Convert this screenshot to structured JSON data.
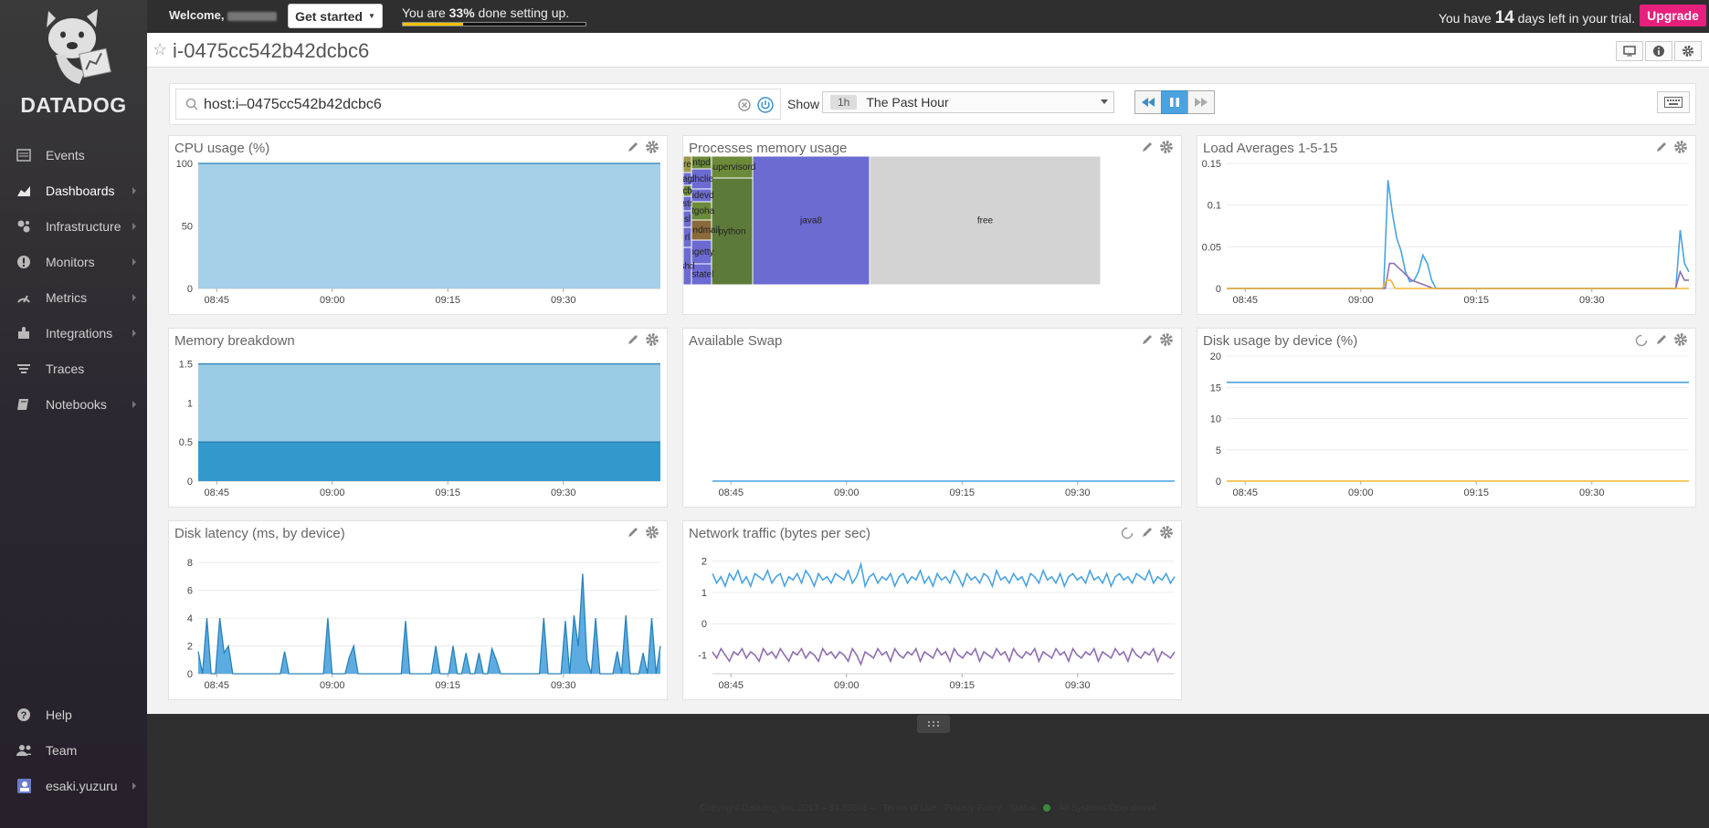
{
  "app": {
    "logo_text": "DATADOG"
  },
  "sidebar": {
    "items": [
      {
        "label": "Events",
        "icon": "events-icon"
      },
      {
        "label": "Dashboards",
        "icon": "dashboards-icon"
      },
      {
        "label": "Infrastructure",
        "icon": "infrastructure-icon"
      },
      {
        "label": "Monitors",
        "icon": "monitors-icon"
      },
      {
        "label": "Metrics",
        "icon": "metrics-icon"
      },
      {
        "label": "Integrations",
        "icon": "integrations-icon"
      },
      {
        "label": "Traces",
        "icon": "traces-icon"
      },
      {
        "label": "Notebooks",
        "icon": "notebooks-icon"
      }
    ],
    "bottom_items": [
      {
        "label": "Help",
        "icon": "help-icon"
      },
      {
        "label": "Team",
        "icon": "team-icon"
      },
      {
        "label": "esaki.yuzuru",
        "icon": "user-icon"
      }
    ]
  },
  "topbar": {
    "welcome": "Welcome,",
    "get_started": "Get started",
    "setup_prefix": "You are ",
    "setup_percent": "33%",
    "setup_suffix": " done setting up.",
    "setup_progress": 0.33,
    "trial_prefix": "You have ",
    "trial_days": "14",
    "trial_suffix": " days left in your trial.",
    "upgrade": "Upgrade",
    "upgrade_color": "#e6207c"
  },
  "page": {
    "title": "i-0475cc542b42dcbc6"
  },
  "controls": {
    "search_value": "host:i–0475cc542b42dcbc6",
    "show_label": "Show",
    "time_badge": "1h",
    "time_label": "The Past Hour"
  },
  "widgets": [
    {
      "id": "cpu",
      "title": "CPU usage (%)"
    },
    {
      "id": "procmem",
      "title": "Processes memory usage"
    },
    {
      "id": "load",
      "title": "Load Averages 1-5-15"
    },
    {
      "id": "mem",
      "title": "Memory breakdown"
    },
    {
      "id": "swap",
      "title": "Available Swap"
    },
    {
      "id": "disk",
      "title": "Disk usage by device (%)"
    },
    {
      "id": "latency",
      "title": "Disk latency (ms, by device)"
    },
    {
      "id": "net",
      "title": "Network traffic (bytes per sec)"
    }
  ],
  "chart_data": [
    {
      "type": "area",
      "title": "CPU usage (%)",
      "x_ticks": [
        "08:45",
        "09:00",
        "09:15",
        "09:30"
      ],
      "y_ticks": [
        0,
        50,
        100
      ],
      "ylim": [
        0,
        100
      ],
      "series": [
        {
          "values": [
            100,
            100,
            100,
            100,
            100
          ],
          "color": "#9bcce6"
        }
      ]
    },
    {
      "type": "heatmap",
      "title": "Processes memory usage",
      "cells": [
        {
          "label": "free",
          "color": "#d3d3d3"
        },
        {
          "label": "java8",
          "color": "#6b6bd1"
        },
        {
          "label": "python",
          "color": "#5e7a3a"
        },
        {
          "label": "supervisord",
          "color": "#6b8a3a"
        },
        {
          "label": "ntpd",
          "color": "#6b8a3a"
        },
        {
          "label": "dhclie",
          "color": "#6b6bd1"
        },
        {
          "label": "udevd",
          "color": "#6b6bd1"
        },
        {
          "label": "rtgoha",
          "color": "#6b8a3a"
        },
        {
          "label": "sendmail",
          "color": "#8a6a3a"
        },
        {
          "label": "ngetty",
          "color": "#6b6bd1"
        },
        {
          "label": ".statel",
          "color": "#6b6bd1"
        },
        {
          "label": "re",
          "color": "#9a9a4a"
        },
        {
          "label": "ag",
          "color": "#6b6bd1"
        },
        {
          "label": "cb",
          "color": "#6b8a3a"
        },
        {
          "label": "str",
          "color": "#6b6bd1"
        },
        {
          "label": "sl",
          "color": "#6b6bd1"
        },
        {
          "label": "rl",
          "color": "#6b6bd1"
        },
        {
          "label": "shd",
          "color": "#6b6bd1"
        }
      ]
    },
    {
      "type": "line",
      "title": "Load Averages 1-5-15",
      "x_ticks": [
        "08:45",
        "09:00",
        "09:15",
        "09:30"
      ],
      "y_ticks": [
        0,
        0.05,
        0.1,
        0.15
      ],
      "ylim": [
        0,
        0.15
      ],
      "series": [
        {
          "color": "#4aa3df",
          "values": [
            0,
            0,
            0,
            0,
            0,
            0,
            0,
            0,
            0,
            0,
            0,
            0,
            0,
            0,
            0,
            0,
            0,
            0,
            0,
            0,
            0,
            0,
            0,
            0,
            0,
            0,
            0,
            0,
            0,
            0,
            0,
            0,
            0,
            0,
            0,
            0,
            0,
            0.13,
            0.09,
            0.06,
            0.045,
            0.02,
            0.008,
            0.01,
            0.02,
            0.04,
            0.03,
            0.01,
            0,
            0,
            0,
            0,
            0,
            0,
            0,
            0,
            0,
            0,
            0,
            0,
            0,
            0,
            0,
            0,
            0,
            0,
            0,
            0,
            0,
            0,
            0,
            0,
            0,
            0,
            0,
            0,
            0,
            0,
            0,
            0,
            0,
            0,
            0,
            0,
            0,
            0,
            0,
            0,
            0,
            0,
            0,
            0,
            0,
            0,
            0,
            0,
            0,
            0,
            0,
            0,
            0,
            0,
            0,
            0,
            0.07,
            0.03,
            0.02
          ]
        },
        {
          "color": "#8e6fb0",
          "values": [
            0,
            0,
            0,
            0,
            0,
            0,
            0,
            0,
            0,
            0,
            0,
            0,
            0,
            0,
            0,
            0,
            0,
            0,
            0,
            0,
            0,
            0,
            0,
            0,
            0,
            0,
            0,
            0,
            0,
            0,
            0,
            0,
            0,
            0,
            0,
            0,
            0,
            0.03,
            0.03,
            0.025,
            0.02,
            0.015,
            0.01,
            0.008,
            0.006,
            0.004,
            0.002,
            0,
            0,
            0,
            0,
            0,
            0,
            0,
            0,
            0,
            0,
            0,
            0,
            0,
            0,
            0,
            0,
            0,
            0,
            0,
            0,
            0,
            0,
            0,
            0,
            0,
            0,
            0,
            0,
            0,
            0,
            0,
            0,
            0,
            0,
            0,
            0,
            0,
            0,
            0,
            0,
            0,
            0,
            0,
            0,
            0,
            0,
            0,
            0,
            0,
            0,
            0,
            0,
            0,
            0,
            0,
            0,
            0.02,
            0.01,
            0.01
          ]
        },
        {
          "color": "#f2b632",
          "values": [
            0,
            0,
            0,
            0,
            0,
            0,
            0,
            0,
            0,
            0,
            0,
            0,
            0,
            0,
            0,
            0,
            0,
            0,
            0,
            0,
            0,
            0,
            0,
            0,
            0,
            0,
            0,
            0,
            0,
            0,
            0,
            0,
            0,
            0,
            0,
            0,
            0,
            0.01,
            0.01,
            0,
            0,
            0,
            0,
            0,
            0,
            0,
            0,
            0,
            0,
            0,
            0,
            0,
            0,
            0,
            0,
            0,
            0,
            0,
            0,
            0,
            0,
            0,
            0,
            0,
            0,
            0,
            0,
            0,
            0,
            0,
            0,
            0,
            0,
            0,
            0,
            0,
            0,
            0,
            0,
            0,
            0,
            0,
            0,
            0,
            0,
            0,
            0,
            0,
            0,
            0,
            0,
            0,
            0,
            0,
            0,
            0,
            0,
            0,
            0,
            0,
            0,
            0,
            0,
            0,
            0,
            0,
            0,
            0
          ]
        }
      ]
    },
    {
      "type": "area",
      "title": "Memory breakdown",
      "x_ticks": [
        "08:45",
        "09:00",
        "09:15",
        "09:30"
      ],
      "y_ticks": [
        0,
        0.5,
        1,
        1.5
      ],
      "ylim": [
        0,
        1.6
      ],
      "series": [
        {
          "values": [
            1.5,
            1.5
          ],
          "color": "#9bcce6"
        },
        {
          "values": [
            0.5,
            0.5
          ],
          "color": "#3399cc"
        }
      ]
    },
    {
      "type": "line",
      "title": "Available Swap",
      "x_ticks": [
        "08:45",
        "09:00",
        "09:15",
        "09:30"
      ],
      "y_ticks": [],
      "ylim": [
        0,
        1
      ],
      "series": [
        {
          "values": [
            0,
            0
          ],
          "color": "#4aa3df"
        }
      ]
    },
    {
      "type": "line",
      "title": "Disk usage by device (%)",
      "x_ticks": [
        "08:45",
        "09:00",
        "09:15",
        "09:30"
      ],
      "y_ticks": [
        0,
        5,
        10,
        15,
        20
      ],
      "ylim": [
        0,
        20
      ],
      "series": [
        {
          "values": [
            15.8,
            15.8
          ],
          "color": "#4aa3df"
        },
        {
          "values": [
            0,
            0
          ],
          "color": "#f2b632"
        }
      ]
    },
    {
      "type": "area",
      "title": "Disk latency (ms, by device)",
      "x_ticks": [
        "08:45",
        "09:00",
        "09:15",
        "09:30"
      ],
      "y_ticks": [
        0,
        2,
        4,
        6,
        8
      ],
      "ylim": [
        0,
        9
      ],
      "series": [
        {
          "color": "#4aa3df",
          "values": [
            1.6,
            0,
            4,
            0,
            0,
            4,
            1.5,
            2,
            0,
            0,
            0,
            0,
            0,
            0,
            0,
            0,
            0,
            0,
            0,
            0,
            1.6,
            0,
            0,
            0,
            0,
            0,
            0,
            0,
            0,
            0,
            4,
            0,
            0,
            0,
            0,
            1.2,
            2,
            0,
            0,
            0,
            0,
            0,
            0,
            0,
            0,
            0,
            0,
            0,
            3.8,
            0,
            0,
            0,
            0,
            0,
            0,
            2,
            0,
            0,
            0,
            2,
            0,
            0,
            1.5,
            0,
            0,
            1.5,
            0,
            0,
            1.8,
            1,
            0,
            0,
            0,
            0,
            0,
            0,
            0,
            0,
            0,
            0,
            4,
            0,
            0,
            0,
            0,
            3.8,
            0,
            4.2,
            2,
            7.2,
            1,
            0,
            4,
            0,
            0,
            0,
            0,
            1.6,
            0,
            4.2,
            0,
            0,
            0,
            1.5,
            0,
            4,
            0,
            2
          ]
        }
      ]
    },
    {
      "type": "line",
      "title": "Network traffic (bytes per sec)",
      "x_ticks": [
        "08:45",
        "09:00",
        "09:15",
        "09:30"
      ],
      "y_ticks": [
        -1,
        0,
        1,
        2
      ],
      "ylim": [
        -1.6,
        2.4
      ],
      "series": [
        {
          "color": "#4aa3df",
          "values": [
            1.6,
            1.3,
            1.5,
            1.2,
            1.6,
            1.4,
            1.7,
            1.3,
            1.5,
            1.2,
            1.6,
            1.5,
            1.4,
            1.7,
            1.3,
            1.5,
            1.6,
            1.2,
            1.5,
            1.4,
            1.6,
            1.3,
            1.7,
            1.5,
            1.2,
            1.6,
            1.4,
            1.5,
            1.3,
            1.6,
            1.5,
            1.4,
            1.7,
            1.3,
            1.5,
            1.9,
            1.2,
            1.5,
            1.6,
            1.3,
            1.5,
            1.4,
            1.6,
            1.2,
            1.5,
            1.6,
            1.3,
            1.5,
            1.4,
            1.7,
            1.3,
            1.5,
            1.2,
            1.6,
            1.4,
            1.5,
            1.3,
            1.7,
            1.5,
            1.2,
            1.6,
            1.4,
            1.5,
            1.3,
            1.6,
            1.5,
            1.2,
            1.7,
            1.4,
            1.5,
            1.3,
            1.6,
            1.4,
            1.5,
            1.2,
            1.6,
            1.5,
            1.3,
            1.7,
            1.4,
            1.5,
            1.3,
            1.6,
            1.2,
            1.5,
            1.6,
            1.4,
            1.5,
            1.3,
            1.7,
            1.4,
            1.5,
            1.3,
            1.6,
            1.2,
            1.5,
            1.6,
            1.4,
            1.5,
            1.3,
            1.6,
            1.5,
            1.4,
            1.7,
            1.3,
            1.5,
            1.4,
            1.6,
            1.3,
            1.5
          ]
        },
        {
          "color": "#8e6fb0",
          "values": [
            -0.9,
            -1.1,
            -0.8,
            -1.0,
            -1.2,
            -0.9,
            -1.0,
            -0.8,
            -1.1,
            -0.9,
            -1.0,
            -1.2,
            -0.8,
            -1.0,
            -0.9,
            -1.1,
            -0.8,
            -1.0,
            -1.2,
            -0.9,
            -1.0,
            -0.8,
            -1.1,
            -0.9,
            -1.0,
            -1.2,
            -0.8,
            -1.0,
            -0.9,
            -1.1,
            -0.9,
            -1.0,
            -1.2,
            -0.8,
            -1.0,
            -1.3,
            -0.9,
            -1.0,
            -1.1,
            -0.8,
            -1.0,
            -0.9,
            -1.2,
            -0.8,
            -1.0,
            -1.1,
            -0.9,
            -1.0,
            -0.8,
            -1.2,
            -0.9,
            -1.0,
            -1.1,
            -0.8,
            -1.0,
            -0.9,
            -1.2,
            -0.8,
            -1.0,
            -1.1,
            -0.9,
            -1.0,
            -0.8,
            -1.2,
            -0.9,
            -1.0,
            -1.1,
            -0.8,
            -1.0,
            -0.9,
            -1.2,
            -0.8,
            -1.0,
            -1.1,
            -0.9,
            -1.0,
            -0.8,
            -1.2,
            -0.9,
            -1.0,
            -1.1,
            -0.8,
            -1.0,
            -0.9,
            -1.2,
            -0.8,
            -1.0,
            -1.1,
            -0.9,
            -1.0,
            -0.8,
            -1.2,
            -0.9,
            -1.0,
            -1.1,
            -0.8,
            -1.0,
            -0.9,
            -1.2,
            -0.8,
            -1.0,
            -1.1,
            -0.9,
            -1.0,
            -0.8,
            -1.2,
            -0.9,
            -1.0,
            -1.1,
            -0.9
          ]
        }
      ]
    }
  ],
  "footer": {
    "copyright": "Copyright Datadog, Inc. 2017 – 34.33698 –",
    "terms": "Terms of Use",
    "privacy": "Privacy Policy",
    "status": "Status",
    "systems": "All Systems Operational"
  }
}
